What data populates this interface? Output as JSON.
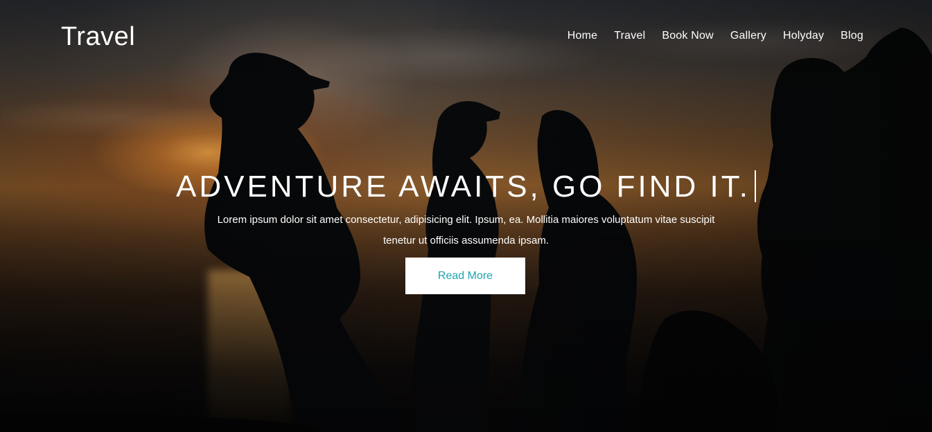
{
  "header": {
    "brand": "Travel",
    "nav": [
      {
        "label": "Home"
      },
      {
        "label": "Travel"
      },
      {
        "label": "Book Now"
      },
      {
        "label": "Gallery"
      },
      {
        "label": "Holyday"
      },
      {
        "label": "Blog"
      }
    ]
  },
  "hero": {
    "headline": "ADVENTURE AWAITS, GO FIND IT.",
    "subtitle": "Lorem ipsum dolor sit amet consectetur, adipisicing elit. Ipsum, ea. Mollitia maiores voluptatum vitae suscipit tenetur ut officiis assumenda ipsam.",
    "cta_label": "Read More"
  },
  "colors": {
    "text": "#ffffff",
    "cta_background": "#ffffff",
    "cta_text": "#1aa4b0"
  }
}
